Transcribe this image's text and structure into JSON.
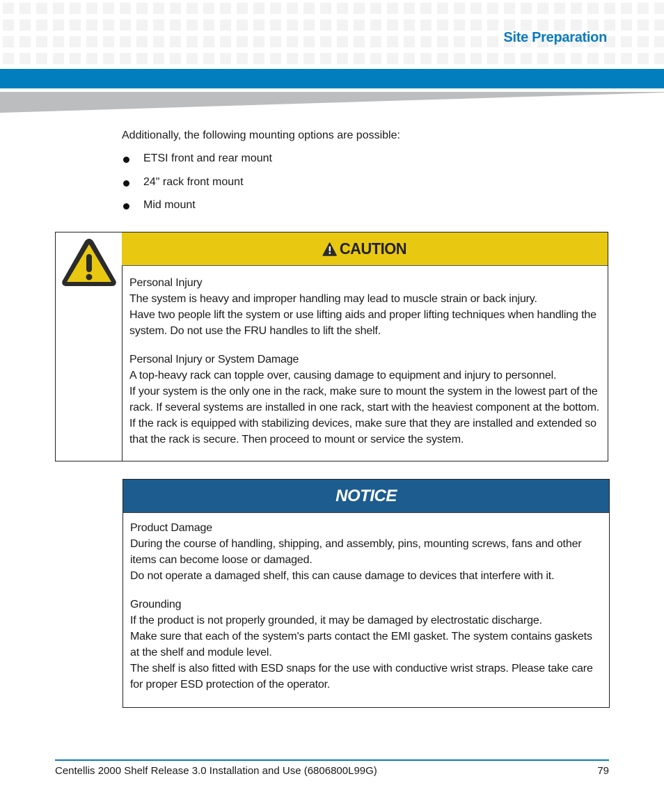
{
  "header": {
    "section_title": "Site Preparation",
    "accent_color": "#027dbd"
  },
  "intro": "Additionally, the following mounting options are possible:",
  "mounting_options": [
    "ETSI front and rear mount",
    "24\" rack front mount",
    "Mid mount"
  ],
  "caution": {
    "label": "CAUTION",
    "icon": "warning-triangle-icon",
    "color": "#e9c811",
    "messages": [
      {
        "title": "Personal Injury",
        "lines": [
          "The system is heavy and improper handling may lead to muscle strain or back injury.",
          "Have two people lift the system or use lifting aids and proper lifting techniques when handling the system. Do not use the FRU handles to lift the shelf."
        ]
      },
      {
        "title": "Personal Injury or System Damage",
        "lines": [
          "A top-heavy rack can topple over, causing damage to equipment and injury to personnel.",
          "If your system is the only one in the rack, make sure to mount the system in the lowest part of the rack. If several systems are installed in one rack, start with the heaviest component at the bottom. If the rack is equipped with stabilizing devices, make sure that they are installed and extended so that the rack is secure. Then proceed to mount or service the system."
        ]
      }
    ]
  },
  "notice": {
    "label": "NOTICE",
    "color": "#1d5c8e",
    "messages": [
      {
        "title": "Product Damage",
        "lines": [
          "During the course of handling, shipping, and assembly, pins, mounting screws, fans and other items can become loose or damaged.",
          "Do not operate a damaged shelf, this can cause damage to devices that interfere with it."
        ]
      },
      {
        "title": "Grounding",
        "lines": [
          "If the product is not properly grounded, it may be damaged by electrostatic discharge.",
          "Make sure that each of the system's parts contact the EMI gasket. The system contains gaskets at the shelf and module level.",
          "The shelf is also fitted with ESD snaps for the use with conductive wrist straps. Please take care for proper ESD protection of the operator."
        ]
      }
    ]
  },
  "footer": {
    "document_title": "Centellis 2000 Shelf Release 3.0 Installation and Use (6806800L99G)",
    "page_number": "79"
  }
}
